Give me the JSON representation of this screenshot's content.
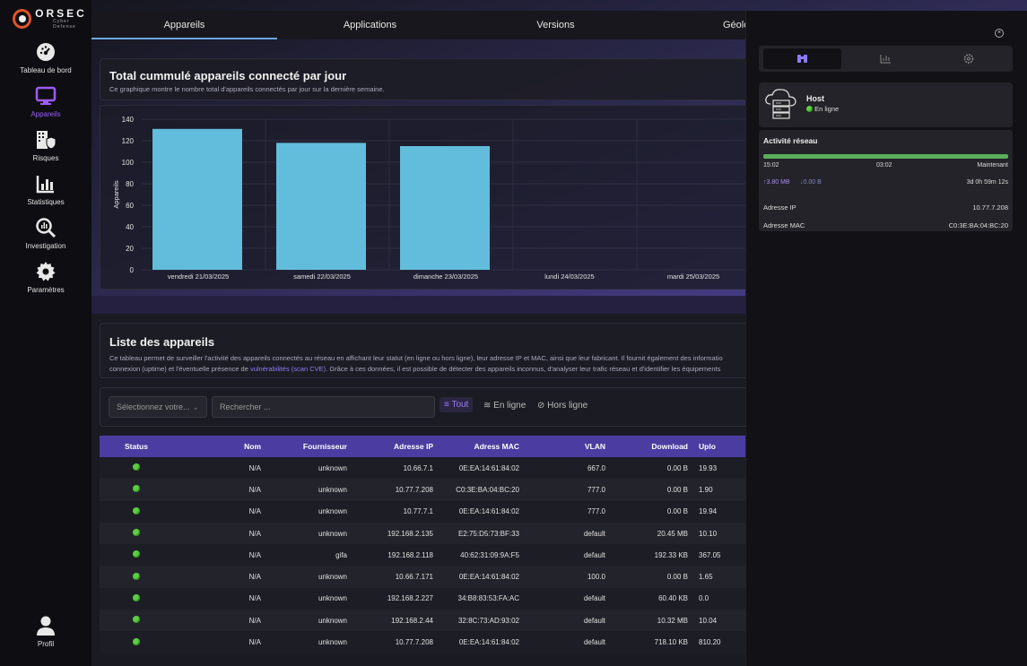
{
  "brand": {
    "name": "ORSEC",
    "tagline": "Cyber Defense"
  },
  "nav": [
    {
      "label": "Tableau de bord",
      "icon": "dashboard-gauge-icon"
    },
    {
      "label": "Appareils",
      "icon": "monitor-icon",
      "active": true
    },
    {
      "label": "Risques",
      "icon": "building-shield-icon"
    },
    {
      "label": "Statistiques",
      "icon": "bar-chart-icon"
    },
    {
      "label": "Investigation",
      "icon": "magnifier-chart-icon"
    },
    {
      "label": "Paramètres",
      "icon": "gear-icon"
    }
  ],
  "profile": {
    "label": "Profil"
  },
  "tabs": [
    {
      "label": "Appareils",
      "active": true
    },
    {
      "label": "Applications"
    },
    {
      "label": "Versions"
    },
    {
      "label": "Géoloca"
    }
  ],
  "chart_section": {
    "title": "Total cummulé appareils connecté par jour",
    "description": "Ce graphique montre le nombre total d'appareils connectés par jour sur la dernière semaine."
  },
  "chart_data": {
    "type": "bar",
    "categories": [
      "vendredi 21/03/2025",
      "samedi 22/03/2025",
      "dimanche 23/03/2025",
      "lundi 24/03/2025",
      "mardi 25/03/2025"
    ],
    "values": [
      131,
      118,
      115,
      null,
      null
    ],
    "ylabel": "Appareils",
    "ylim": [
      0,
      140
    ],
    "yticks": [
      0,
      20,
      40,
      60,
      80,
      100,
      120,
      140
    ],
    "grid": true,
    "bar_color": "#62bcdb"
  },
  "list_section": {
    "title": "Liste des appareils",
    "description_1": "Ce tableau permet de surveiller l'activité des appareils connectés au réseau en affichant leur statut (en ligne ou hors ligne), leur adresse IP et MAC, ainsi que leur fabricant. Il fournit également des informatio",
    "description_2a": "connexion (uptime) et l'éventuelle présence de ",
    "description_link": "vulnérabilités (scan CVE)",
    "description_2b": ". Grâce à ces données, il est possible de détecter des appareils inconnus, d'analyser leur trafic réseau et d'identifier les équipements"
  },
  "filters": {
    "select_placeholder": "Sélectionnez votre...",
    "search_placeholder": "Rechercher ...",
    "all": "Tout",
    "online": "En ligne",
    "offline": "Hors ligne"
  },
  "table": {
    "headers": [
      "Status",
      "Nom",
      "Fournisseur",
      "Adresse IP",
      "Adress MAC",
      "VLAN",
      "Download",
      "Uplo"
    ],
    "rows": [
      [
        "N/A",
        "unknown",
        "10.66.7.1",
        "0E:EA:14:61:84:02",
        "667.0",
        "0.00 B",
        "19.93"
      ],
      [
        "N/A",
        "unknown",
        "10.77.7.208",
        "C0:3E:BA:04:BC:20",
        "777.0",
        "0.00 B",
        "1.90"
      ],
      [
        "N/A",
        "unknown",
        "10.77.7.1",
        "0E:EA:14:61:84:02",
        "777.0",
        "0.00 B",
        "19.94"
      ],
      [
        "N/A",
        "unknown",
        "192.168.2.135",
        "E2:75:D5:73:BF:33",
        "default",
        "20.45 MB",
        "10.10"
      ],
      [
        "N/A",
        "gifa",
        "192.168.2.118",
        "40:62:31:09:9A:F5",
        "default",
        "192.33 KB",
        "367.05"
      ],
      [
        "N/A",
        "unknown",
        "10.66.7.171",
        "0E:EA:14:61:84:02",
        "100.0",
        "0.00 B",
        "1.65"
      ],
      [
        "N/A",
        "unknown",
        "192.168.2.227",
        "34:B8:83:53:FA:AC",
        "default",
        "60.40 KB",
        "0.0"
      ],
      [
        "N/A",
        "unknown",
        "192.168.2.44",
        "32:8C:73:AD:93:02",
        "default",
        "10.32 MB",
        "10.04"
      ],
      [
        "N/A",
        "unknown",
        "10.77.7.208",
        "0E:EA:14:61:84:02",
        "default",
        "718.10 KB",
        "810.20"
      ]
    ]
  },
  "panel": {
    "host_title": "Host",
    "host_status": "En ligne",
    "activity_title": "Activité réseau",
    "time_start": "15:02",
    "time_mid": "03:02",
    "time_end": "Maintenant",
    "upload": "↑3.80 MB",
    "download": "↓0.00 B",
    "uptime": "3d 0h 59m 12s",
    "ip_label": "Adresse IP",
    "ip_value": "10.77.7.208",
    "mac_label": "Adresse MAC",
    "mac_value": "C0:3E:BA:04:BC:20"
  }
}
